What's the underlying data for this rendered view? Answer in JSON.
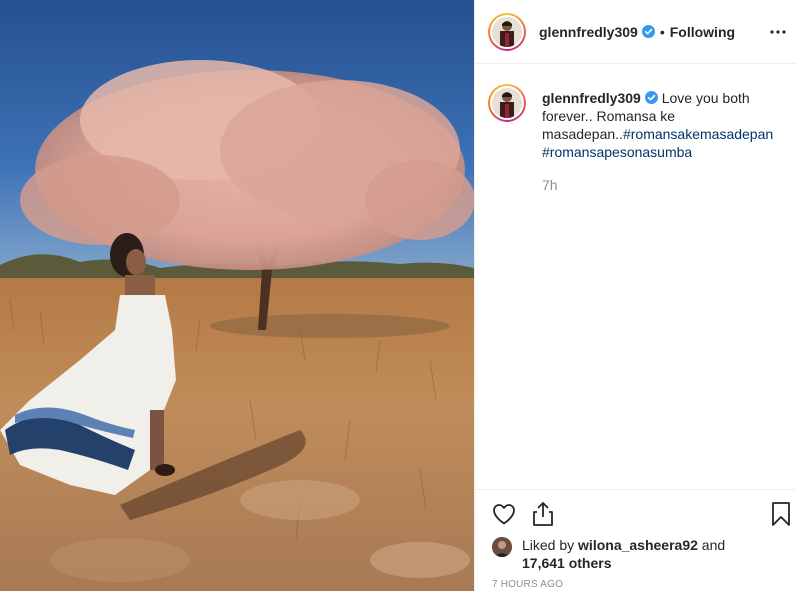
{
  "post": {
    "image_alt": "Woman in white dress beside flowering tree",
    "image_icon": "photo"
  },
  "header": {
    "username": "glennfredly309",
    "separator": "•",
    "follow_state": "Following",
    "more_icon": "more-horizontal-icon",
    "verified_icon": "verified-badge-icon"
  },
  "caption": {
    "username": "glennfredly309",
    "text": "Love you both forever.. Romansa ke masadepan..",
    "hashtag1": "#romansakemasadepan",
    "hashtag2": "#romansapesonasumba",
    "time_ago": "7h"
  },
  "actions": {
    "like_icon": "heart-icon",
    "share_icon": "share-icon",
    "save_icon": "bookmark-icon"
  },
  "likes": {
    "prefix": "Liked by",
    "liker": "wilona_asheera92",
    "and": "and",
    "others": "17,641 others"
  },
  "timestamp": "7 HOURS AGO",
  "colors": {
    "hashtag": "#003569",
    "verified": "#3897f0",
    "muted": "#8e8e8e",
    "text": "#262626"
  }
}
